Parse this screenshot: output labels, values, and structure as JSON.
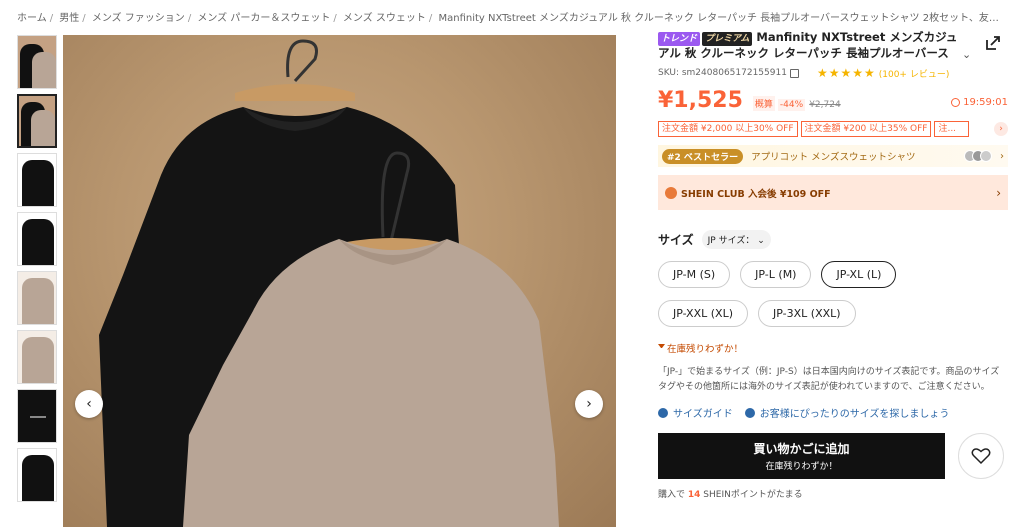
{
  "breadcrumb": [
    "ホーム",
    "男性",
    "メンズ ファッション",
    "メンズ パーカー＆スウェット",
    "メンズ スウェット",
    "Manfinity NXTstreet メンズカジュアル 秋 クルーネック レターパッチ 長袖プルオーバースウェットシャツ 2枚セット、友人、夫、彼..."
  ],
  "gallery": {
    "thumbnails": [
      "thumb-1",
      "thumb-2",
      "thumb-3",
      "thumb-4",
      "thumb-5",
      "thumb-6",
      "thumb-7",
      "thumb-8"
    ],
    "active_index": 1,
    "prev_icon": "‹",
    "next_icon": "›"
  },
  "product": {
    "badge_trend": "トレンド",
    "badge_premium": "プレミアム",
    "title": "Manfinity NXTstreet メンズカジュアル 秋 クルーネック レターパッチ 長袖プルオーバースウェ...",
    "sku": "SKU: sm2408065172155911",
    "rating_stars": "★★★★★",
    "reviews": "(100+ レビュー)",
    "price": "¥1,525",
    "est_label": "概算",
    "discount": "-44%",
    "original_price": "¥2,724",
    "timer": "19:59:01",
    "coupons": [
      "注文金額 ¥2,000 以上30% OFF",
      "注文金額 ¥200 以上35% OFF",
      "注..."
    ],
    "bestseller_badge": "#2 ベストセラー",
    "bestseller_text": "アプリコット メンズスウェットシャツ",
    "club_text": "SHEIN CLUB 入会後 ¥109 OFF",
    "size_label": "サイズ",
    "size_selector": "JP サイズ：",
    "sizes": [
      "JP-M (S)",
      "JP-L (M)",
      "JP-XL (L)",
      "JP-XXL (XL)",
      "JP-3XL (XXL)"
    ],
    "selected_size_index": 2,
    "stock_warning": "在庫残りわずか！",
    "size_note": "「JP-」で始まるサイズ（例：JP-S）は日本国内向けのサイズ表記です。商品のサイズタグやその他箇所には海外のサイズ表記が使われていますので、ご注意ください。",
    "size_guide_link": "サイズガイド",
    "fit_link": "お客様にぴったりのサイズを探しましょう",
    "cart_button": "買い物かごに追加",
    "cart_sub": "在庫残りわずか！",
    "points_prefix": "購入で",
    "points_value": "14",
    "points_suffix": "SHEINポイントがたまる"
  },
  "colors": {
    "accent": "#fa6338",
    "black_sweater": "#111111",
    "khaki_sweater": "#b8a596",
    "background": "#b8966f"
  }
}
